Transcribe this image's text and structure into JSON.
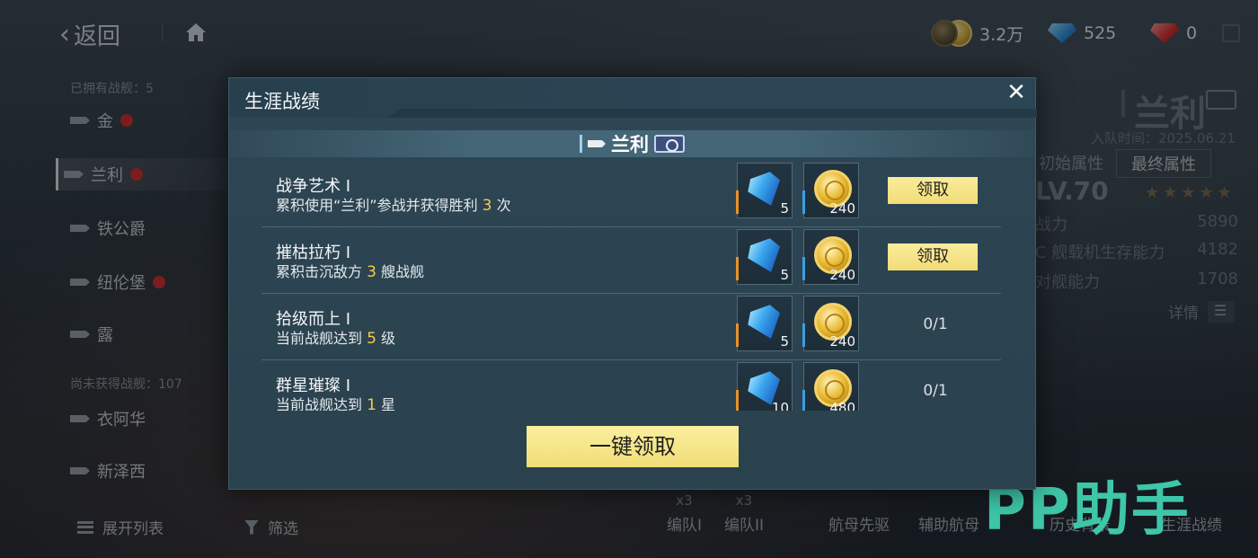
{
  "topbar": {
    "back_label": "返回",
    "currencies": [
      {
        "icon": "gold-coin-icon",
        "value": "3.2万"
      },
      {
        "icon": "blue-diamond-icon",
        "value": "525"
      },
      {
        "icon": "red-diamond-icon",
        "value": "0"
      }
    ]
  },
  "sidebar": {
    "owned_label": "已拥有战舰：5",
    "items": [
      {
        "label": "金",
        "badge": true
      },
      {
        "label": "兰利",
        "badge": true,
        "active": true
      },
      {
        "label": "铁公爵",
        "badge": false
      },
      {
        "label": "纽伦堡",
        "badge": true
      },
      {
        "label": "露",
        "badge": false
      }
    ],
    "unowned_label": "尚未获得战舰：107",
    "unowned_items": [
      {
        "label": "衣阿华"
      },
      {
        "label": "新泽西"
      }
    ],
    "expand_label": "展开列表",
    "filter_label": "筛选"
  },
  "ship_panel": {
    "name": "兰利",
    "join_date": "入队时间：2025.06.21",
    "tab_initial": "初始属性",
    "tab_final": "最终属性",
    "level": "LV.70",
    "stars": "★★★★★",
    "stats": [
      {
        "label": "战力",
        "value": "5890"
      },
      {
        "label": "C 舰载机生存能力",
        "value": "4182"
      },
      {
        "label": "对舰能力",
        "value": "1708"
      }
    ],
    "detail_label": "详情"
  },
  "bottom_bar": {
    "items": [
      {
        "label": "编队I",
        "glyph": "x3"
      },
      {
        "label": "编队II",
        "glyph": "x3"
      },
      {
        "label": "航母先驱",
        "glyph": ""
      },
      {
        "label": "辅助航母",
        "glyph": ""
      },
      {
        "label": "历史背景",
        "glyph": ""
      },
      {
        "label": "生涯战绩",
        "glyph": ""
      }
    ]
  },
  "watermark": "PP助手",
  "modal": {
    "title": "生涯战绩",
    "ship_name": "兰利",
    "tasks": [
      {
        "name": "战争艺术 I",
        "desc_pre": "累积使用“兰利”参战并获得胜利 ",
        "desc_num": "3",
        "desc_post": " 次",
        "reward1_qty": "5",
        "reward2_qty": "240",
        "action": "领取",
        "progress": ""
      },
      {
        "name": "摧枯拉朽 I",
        "desc_pre": "累积击沉敌方 ",
        "desc_num": "3",
        "desc_post": " 艘战舰",
        "reward1_qty": "5",
        "reward2_qty": "240",
        "action": "领取",
        "progress": ""
      },
      {
        "name": "拾级而上 I",
        "desc_pre": "当前战舰达到 ",
        "desc_num": "5",
        "desc_post": " 级",
        "reward1_qty": "5",
        "reward2_qty": "240",
        "action": "",
        "progress": "0/1"
      },
      {
        "name": "群星璀璨 I",
        "desc_pre": "当前战舰达到 ",
        "desc_num": "1",
        "desc_post": " 星",
        "reward1_qty": "10",
        "reward2_qty": "480",
        "action": "",
        "progress": "0/1"
      }
    ],
    "claim_all_label": "一键领取"
  },
  "colors": {
    "accent_yellow": "#f2dc76",
    "highlight_number": "#f5cd4a",
    "modal_bg": "#2b4352",
    "edge_orange": "#e8912a",
    "edge_blue": "#3aa0e0"
  }
}
